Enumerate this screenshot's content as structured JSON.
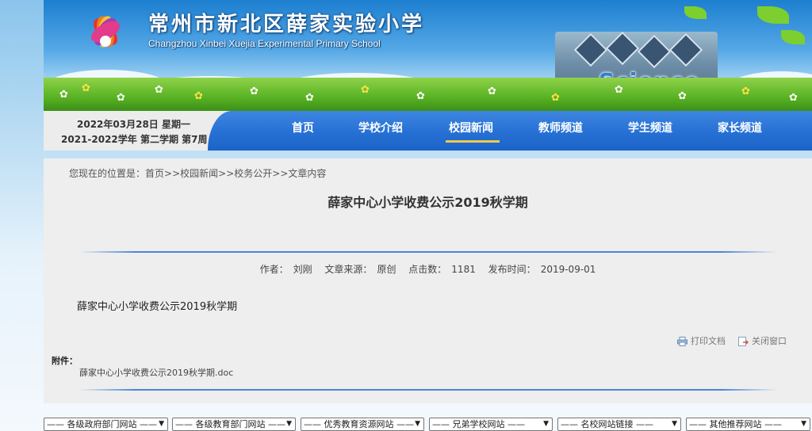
{
  "school": {
    "name_cn": "常州市新北区薛家实验小学",
    "name_en": "Changzhou Xinbei Xuejia Experimental Primary School",
    "banner_word": "Science"
  },
  "date": {
    "line1": "2022年03月28日 星期一",
    "line2": "2021-2022学年 第二学期 第7周"
  },
  "nav": {
    "items": [
      "首页",
      "学校介绍",
      "校园新闻",
      "教师频道",
      "学生频道",
      "家长频道"
    ],
    "active": "校园新闻"
  },
  "breadcrumb": {
    "prefix": "您现在的位置是：",
    "items": [
      "首页",
      "校园新闻",
      "校务公开",
      "文章内容"
    ],
    "separator": ">>"
  },
  "article": {
    "title": "薛家中心小学收费公示2019秋学期",
    "author_label": "作者：",
    "author": "刘刚",
    "source_label": "文章来源：",
    "source": "原创",
    "clicks_label": "点击数：",
    "clicks": "1181",
    "published_label": "发布时间：",
    "published": "2019-09-01",
    "body": "薛家中心小学收费公示2019秋学期"
  },
  "tools": {
    "print": "打印文档",
    "close": "关闭窗口"
  },
  "attachment": {
    "label": "附件：",
    "file": "薛家中心小学收费公示2019秋学期.doc"
  },
  "footer_links": [
    "—— 各级政府部门网站 ——",
    "—— 各级教育部门网站 ——",
    "—— 优秀教育资源网站 ——",
    "—— 兄弟学校网站 ——",
    "—— 名校网站链接 ——",
    "—— 其他推荐网站 ——"
  ],
  "colors": {
    "nav_blue": "#2670d4",
    "active_underline": "#f2c94c",
    "rule_blue": "#4a86d6",
    "content_bg": "#eeeeee"
  }
}
